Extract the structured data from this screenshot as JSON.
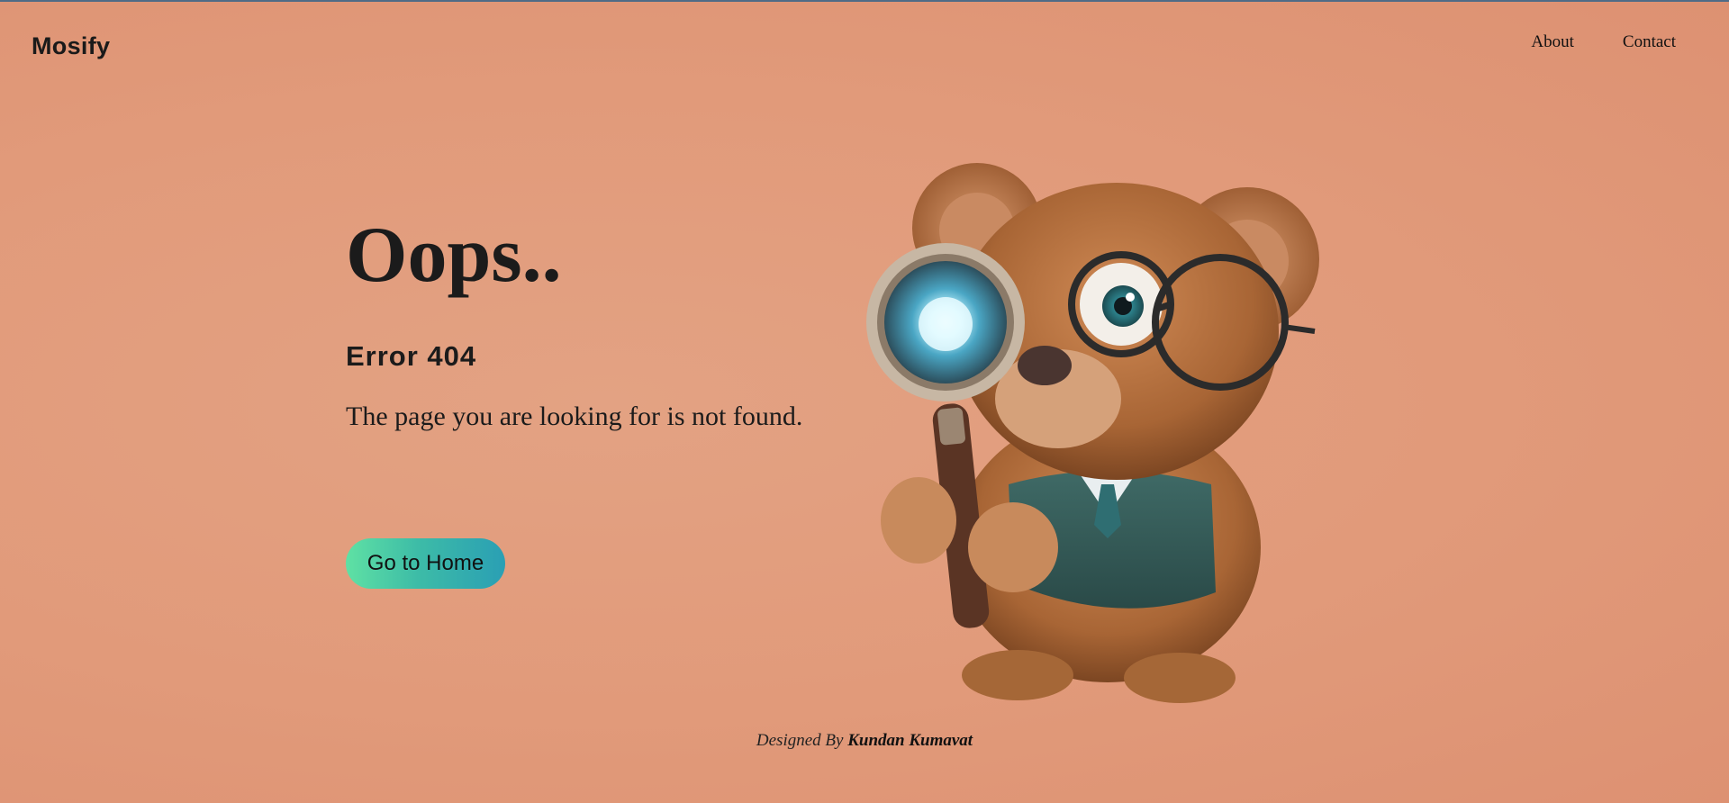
{
  "header": {
    "brand": "Mosify",
    "nav": [
      {
        "label": "About"
      },
      {
        "label": "Contact"
      }
    ]
  },
  "main": {
    "title": "Oops..",
    "error_code": "Error 404",
    "message": "The page you are looking for is not found.",
    "home_button_label": "Go to Home"
  },
  "illustration": {
    "subject": "teddy-bear-detective-with-magnifying-glass"
  },
  "footer": {
    "prefix": "Designed By",
    "author": "Kundan Kumavat"
  },
  "colors": {
    "background": "#e19a7a",
    "button_gradient_start": "#5fe1a4",
    "button_gradient_end": "#2a9fb4"
  }
}
